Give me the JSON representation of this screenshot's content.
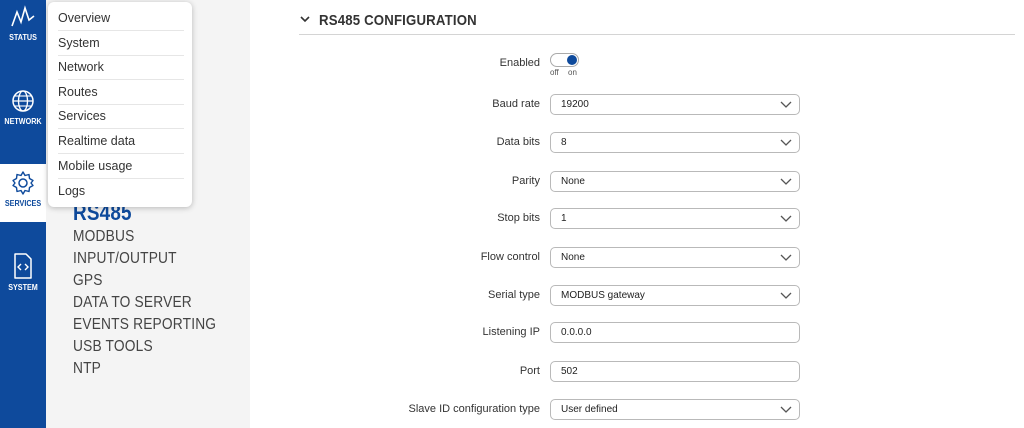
{
  "rail": {
    "items": [
      {
        "label": "STATUS",
        "icon": "pulse-icon"
      },
      {
        "label": "NETWORK",
        "icon": "globe-icon"
      },
      {
        "label": "SERVICES",
        "icon": "gear-icon"
      },
      {
        "label": "SYSTEM",
        "icon": "code-file-icon"
      }
    ]
  },
  "status_menu": {
    "items": [
      "Overview",
      "System",
      "Network",
      "Routes",
      "Services",
      "Realtime data",
      "Mobile usage",
      "Logs"
    ]
  },
  "services_menu": {
    "current": "RS485",
    "items": [
      "MODBUS",
      "INPUT/OUTPUT",
      "GPS",
      "DATA TO SERVER",
      "EVENTS REPORTING",
      "USB TOOLS",
      "NTP"
    ]
  },
  "section": {
    "title": "RS485 CONFIGURATION"
  },
  "form": {
    "enabled": {
      "label": "Enabled",
      "off": "off",
      "on": "on",
      "state": "on"
    },
    "baud_rate": {
      "label": "Baud rate",
      "value": "19200"
    },
    "data_bits": {
      "label": "Data bits",
      "value": "8"
    },
    "parity": {
      "label": "Parity",
      "value": "None"
    },
    "stop_bits": {
      "label": "Stop bits",
      "value": "1"
    },
    "flow_control": {
      "label": "Flow control",
      "value": "None"
    },
    "serial_type": {
      "label": "Serial type",
      "value": "MODBUS gateway"
    },
    "listening_ip": {
      "label": "Listening IP",
      "value": "0.0.0.0"
    },
    "port": {
      "label": "Port",
      "value": "502"
    },
    "slave_id": {
      "label": "Slave ID configuration type",
      "value": "User defined"
    }
  },
  "colors": {
    "brand": "#0e4a9c",
    "submenu_bg": "#f4f4f4"
  }
}
